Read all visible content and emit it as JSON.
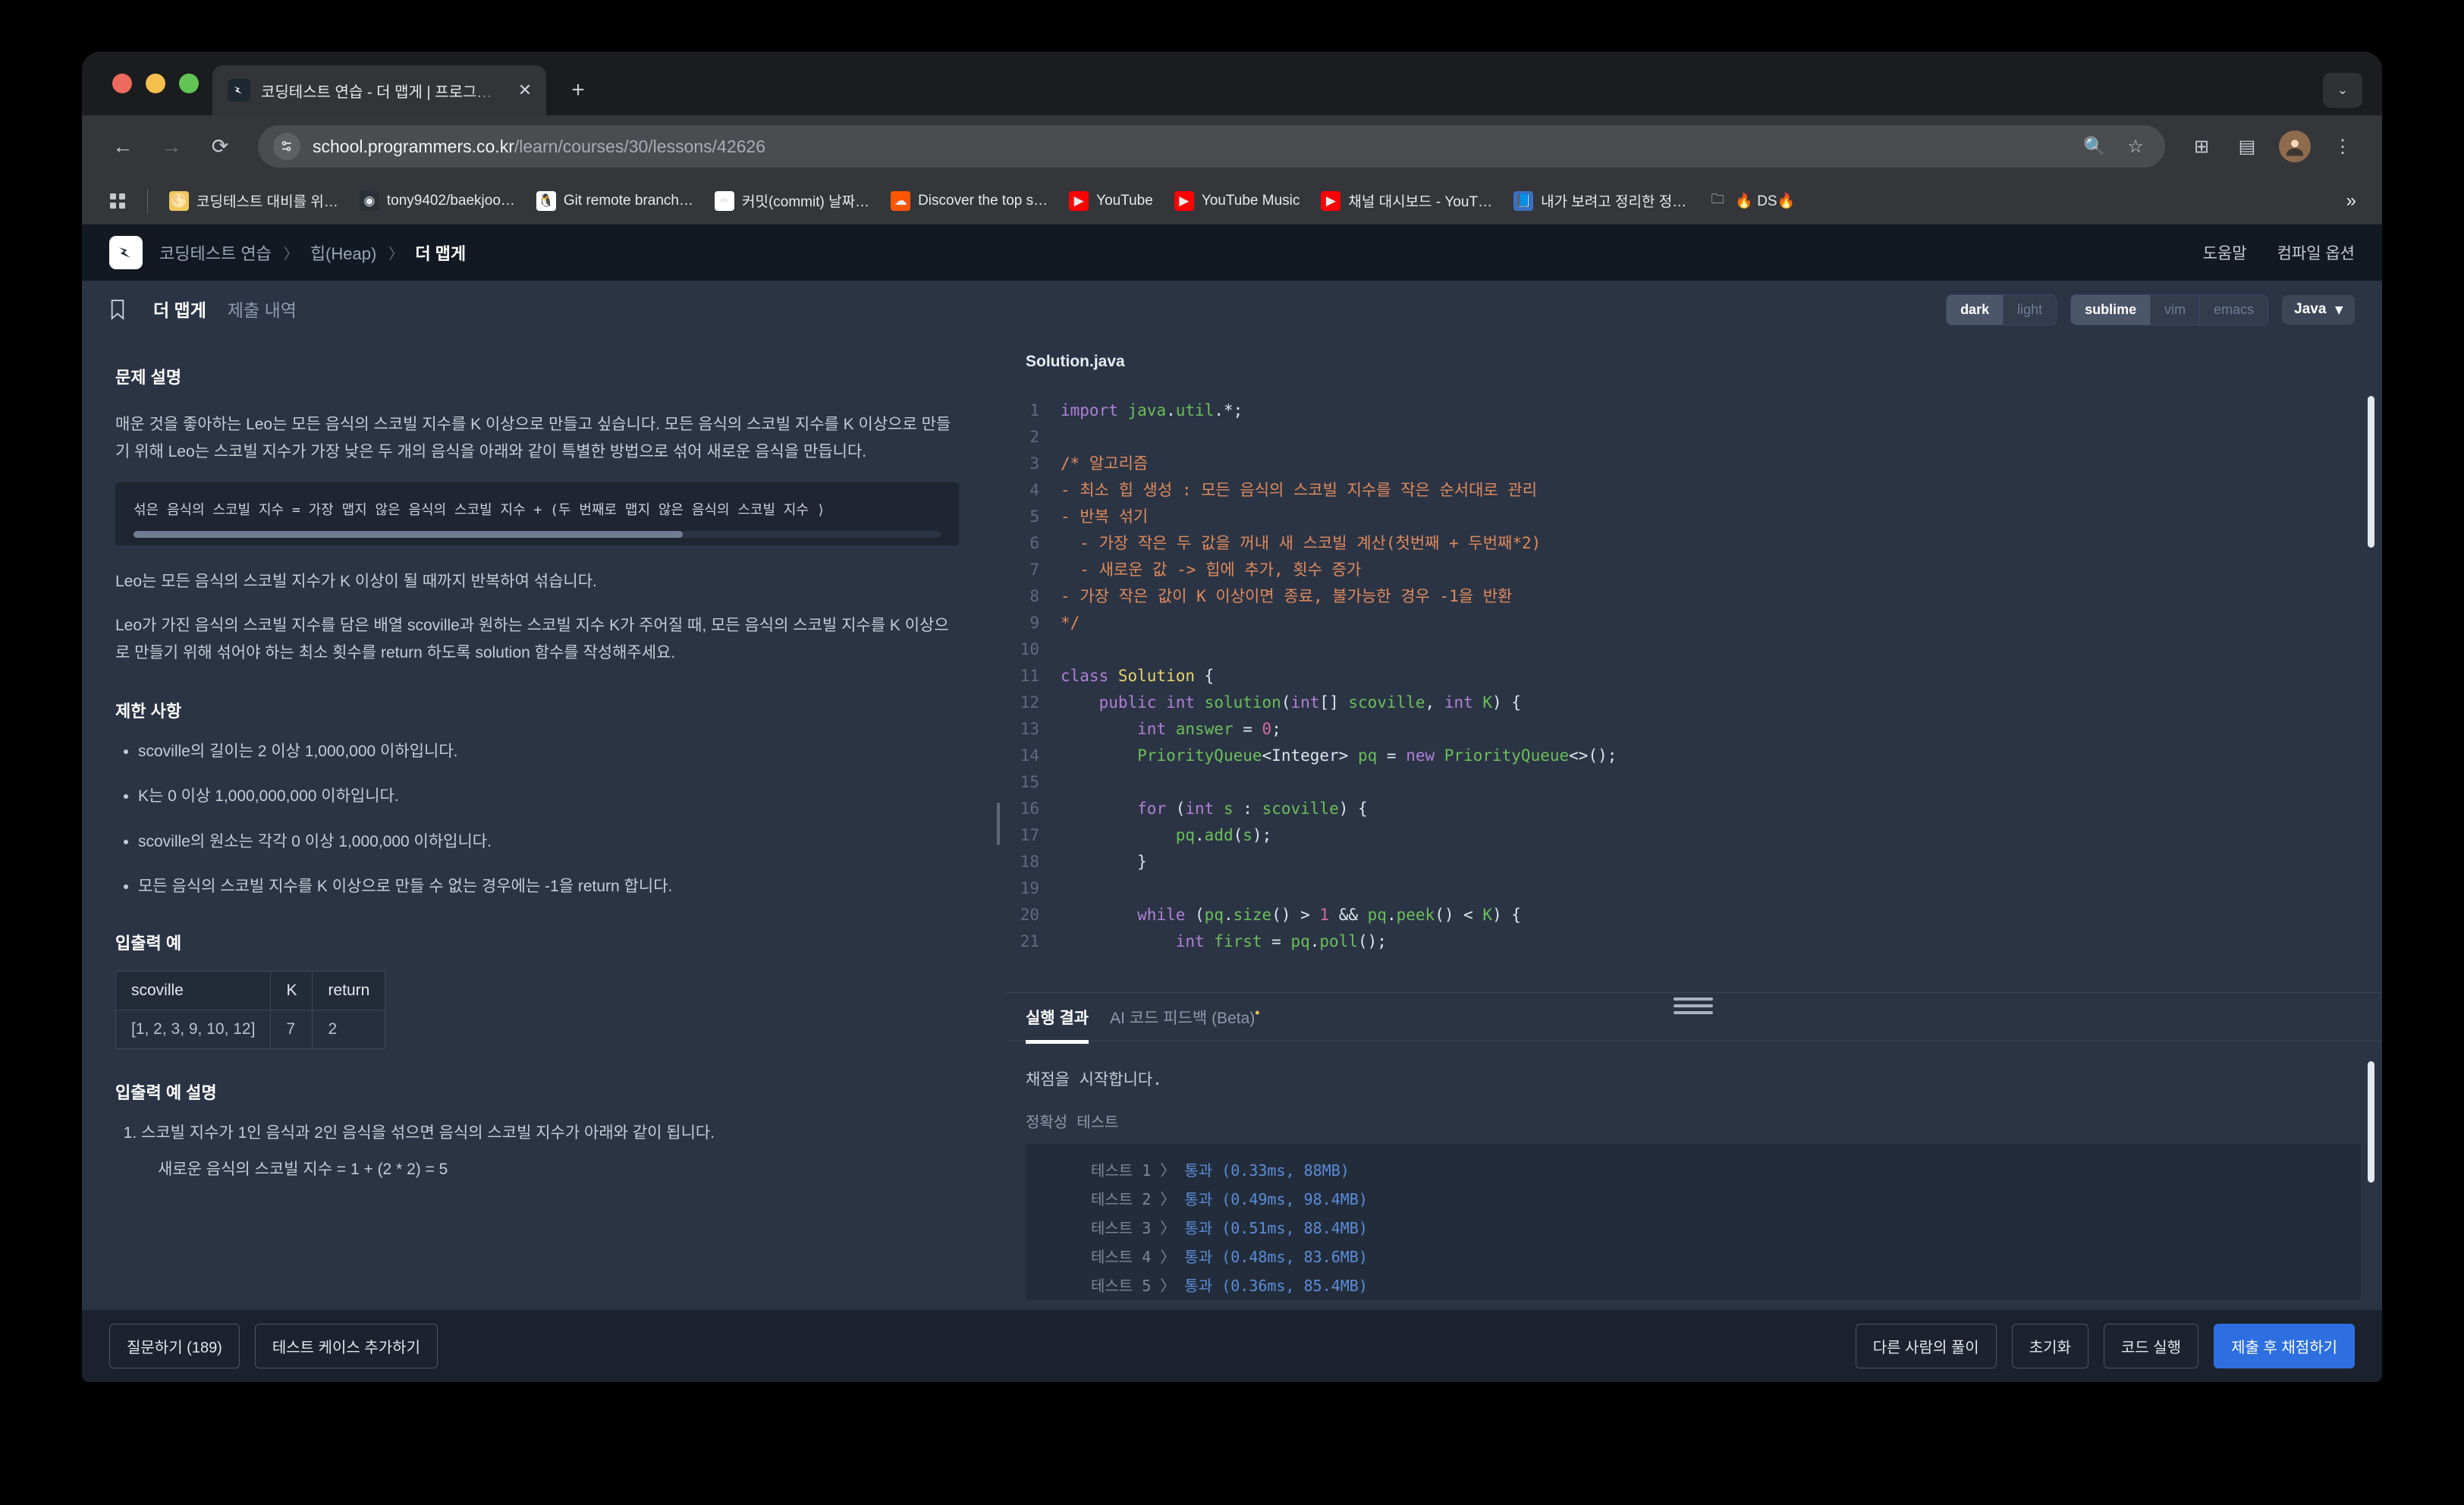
{
  "browser": {
    "tab": {
      "title": "코딩테스트 연습 - 더 맵게 | 프로그…",
      "close_label": "✕"
    },
    "new_tab_label": "+",
    "tabstrip_chevron": "⌄",
    "toolbar": {
      "back": "←",
      "forward": "→",
      "reload": "⟳",
      "url_host": "school.programmers.co.kr",
      "url_path": "/learn/courses/30/lessons/42626",
      "zoom_icon": "🔍",
      "star_icon": "☆",
      "extensions_icon": "⊞",
      "split_icon": "▤",
      "menu_icon": "⋮"
    },
    "bookmarks": [
      {
        "label": "코딩테스트 대비를 위…",
        "icon": "🌕",
        "icon_bg": "#f0c75e"
      },
      {
        "label": "tony9402/baekjoo…",
        "icon": "◉",
        "icon_bg": "#2b3036"
      },
      {
        "label": "Git remote branch…",
        "icon": "🐧",
        "icon_bg": "#ffffff"
      },
      {
        "label": "커밋(commit) 날짜…",
        "icon": "✒",
        "icon_bg": "#ffffff"
      },
      {
        "label": "Discover the top s…",
        "icon": "☁",
        "icon_bg": "#ff5500"
      },
      {
        "label": "YouTube",
        "icon": "▶",
        "icon_bg": "#ff0000"
      },
      {
        "label": "YouTube Music",
        "icon": "▶",
        "icon_bg": "#ff0000"
      },
      {
        "label": "채널 대시보드 - YouT…",
        "icon": "▶",
        "icon_bg": "#ff0000"
      },
      {
        "label": "내가 보려고 정리한 정…",
        "icon": "📘",
        "icon_bg": "#3b6fc4"
      },
      {
        "label": "🔥 DS🔥",
        "icon": "🗀",
        "icon_bg": "transparent"
      }
    ],
    "bookmarks_overflow": "»"
  },
  "site": {
    "breadcrumb": {
      "root": "코딩테스트 연습",
      "sep": "〉",
      "category": "힙(Heap)",
      "current": "더 맵게"
    },
    "header_links": [
      "도움말",
      "컴파일 옵션"
    ]
  },
  "problem_tabs": {
    "bookmark_icon": "bookmark-icon",
    "tabs": [
      {
        "label": "더 맵게",
        "active": true
      },
      {
        "label": "제출 내역",
        "active": false
      }
    ],
    "theme_options": [
      {
        "label": "dark",
        "active": true
      },
      {
        "label": "light",
        "active": false
      }
    ],
    "keymap_options": [
      {
        "label": "sublime",
        "active": true
      },
      {
        "label": "vim",
        "active": false
      },
      {
        "label": "emacs",
        "active": false
      }
    ],
    "language": {
      "label": "Java",
      "caret": "▾"
    }
  },
  "problem": {
    "heading_description": "문제 설명",
    "paragraphs": [
      "매운 것을 좋아하는 Leo는 모든 음식의 스코빌 지수를 K 이상으로 만들고 싶습니다. 모든 음식의 스코빌 지수를 K 이상으로 만들기 위해 Leo는 스코빌 지수가 가장 낮은 두 개의 음식을 아래와 같이 특별한 방법으로 섞어 새로운 음식을 만듭니다."
    ],
    "formula": "섞은 음식의 스코빌 지수 = 가장 맵지 않은 음식의 스코빌 지수 + (두 번째로 맵지 않은 음식의 스코빌 지수 ⟩",
    "paragraphs_after": [
      "Leo는 모든 음식의 스코빌 지수가 K 이상이 될 때까지 반복하여 섞습니다.",
      "Leo가 가진 음식의 스코빌 지수를 담은 배열 scoville과 원하는 스코빌 지수 K가 주어질 때, 모든 음식의 스코빌 지수를 K 이상으로 만들기 위해 섞어야 하는 최소 횟수를 return 하도록 solution 함수를 작성해주세요."
    ],
    "heading_constraints": "제한 사항",
    "constraints": [
      "scoville의 길이는 2 이상 1,000,000 이하입니다.",
      "K는 0 이상 1,000,000,000 이하입니다.",
      "scoville의 원소는 각각 0 이상 1,000,000 이하입니다.",
      "모든 음식의 스코빌 지수를 K 이상으로 만들 수 없는 경우에는 -1을 return 합니다."
    ],
    "heading_io": "입출력 예",
    "io_table": {
      "headers": [
        "scoville",
        "K",
        "return"
      ],
      "rows": [
        [
          "[1, 2, 3, 9, 10, 12]",
          "7",
          "2"
        ]
      ]
    },
    "heading_io_explain": "입출력 예 설명",
    "io_explain_items": [
      "스코빌 지수가 1인 음식과 2인 음식을 섞으면 음식의 스코빌 지수가 아래와 같이 됩니다."
    ],
    "io_explain_sub": "새로운 음식의 스코빌 지수 = 1 + (2 * 2) = 5"
  },
  "editor": {
    "filename": "Solution.java",
    "lines": [
      {
        "no": "1",
        "tokens": [
          {
            "t": "import ",
            "c": "k"
          },
          {
            "t": "java",
            "c": "t"
          },
          {
            "t": ".",
            "c": "op"
          },
          {
            "t": "util",
            "c": "t"
          },
          {
            "t": ".",
            "c": "op"
          },
          {
            "t": "*;",
            "c": "op"
          }
        ]
      },
      {
        "no": "2",
        "tokens": []
      },
      {
        "no": "3",
        "tokens": [
          {
            "t": "/* 알고리즘",
            "c": "cm"
          }
        ]
      },
      {
        "no": "4",
        "tokens": [
          {
            "t": "- 최소 힙 생성 : 모든 음식의 스코빌 지수를 작은 순서대로 관리",
            "c": "cm"
          }
        ]
      },
      {
        "no": "5",
        "tokens": [
          {
            "t": "- 반복 섞기",
            "c": "cm"
          }
        ]
      },
      {
        "no": "6",
        "tokens": [
          {
            "t": "  - 가장 작은 두 값을 꺼내 새 스코빌 계산(첫번째 + 두번째*2)",
            "c": "cm"
          }
        ]
      },
      {
        "no": "7",
        "tokens": [
          {
            "t": "  - 새로운 값 -> 힙에 추가, 횟수 증가",
            "c": "cm"
          }
        ]
      },
      {
        "no": "8",
        "tokens": [
          {
            "t": "- 가장 작은 값이 K 이상이면 종료, 불가능한 경우 -1을 반환",
            "c": "cm"
          }
        ]
      },
      {
        "no": "9",
        "tokens": [
          {
            "t": "*/",
            "c": "cm"
          }
        ]
      },
      {
        "no": "10",
        "tokens": []
      },
      {
        "no": "11",
        "tokens": [
          {
            "t": "class ",
            "c": "k"
          },
          {
            "t": "Solution",
            "c": "s"
          },
          {
            "t": " {",
            "c": "op"
          }
        ]
      },
      {
        "no": "12",
        "tokens": [
          {
            "t": "    ",
            "c": "op"
          },
          {
            "t": "public ",
            "c": "k"
          },
          {
            "t": "int ",
            "c": "k"
          },
          {
            "t": "solution",
            "c": "t"
          },
          {
            "t": "(",
            "c": "op"
          },
          {
            "t": "int",
            "c": "k"
          },
          {
            "t": "[] ",
            "c": "op"
          },
          {
            "t": "scoville",
            "c": "t"
          },
          {
            "t": ", ",
            "c": "op"
          },
          {
            "t": "int ",
            "c": "k"
          },
          {
            "t": "K",
            "c": "t"
          },
          {
            "t": ") {",
            "c": "op"
          }
        ]
      },
      {
        "no": "13",
        "tokens": [
          {
            "t": "        ",
            "c": "op"
          },
          {
            "t": "int ",
            "c": "k"
          },
          {
            "t": "answer",
            "c": "t"
          },
          {
            "t": " = ",
            "c": "op"
          },
          {
            "t": "0",
            "c": "n"
          },
          {
            "t": ";",
            "c": "op"
          }
        ]
      },
      {
        "no": "14",
        "tokens": [
          {
            "t": "        ",
            "c": "op"
          },
          {
            "t": "PriorityQueue",
            "c": "t"
          },
          {
            "t": "<Integer> ",
            "c": "op"
          },
          {
            "t": "pq",
            "c": "t"
          },
          {
            "t": " = ",
            "c": "op"
          },
          {
            "t": "new ",
            "c": "k"
          },
          {
            "t": "PriorityQueue",
            "c": "t"
          },
          {
            "t": "<>();",
            "c": "op"
          }
        ]
      },
      {
        "no": "15",
        "tokens": []
      },
      {
        "no": "16",
        "tokens": [
          {
            "t": "        ",
            "c": "op"
          },
          {
            "t": "for ",
            "c": "k"
          },
          {
            "t": "(",
            "c": "op"
          },
          {
            "t": "int ",
            "c": "k"
          },
          {
            "t": "s",
            "c": "t"
          },
          {
            "t": " : ",
            "c": "op"
          },
          {
            "t": "scoville",
            "c": "t"
          },
          {
            "t": ") {",
            "c": "op"
          }
        ]
      },
      {
        "no": "17",
        "tokens": [
          {
            "t": "            ",
            "c": "op"
          },
          {
            "t": "pq",
            "c": "t"
          },
          {
            "t": ".",
            "c": "op"
          },
          {
            "t": "add",
            "c": "t"
          },
          {
            "t": "(",
            "c": "op"
          },
          {
            "t": "s",
            "c": "t"
          },
          {
            "t": ");",
            "c": "op"
          }
        ]
      },
      {
        "no": "18",
        "tokens": [
          {
            "t": "        }",
            "c": "op"
          }
        ]
      },
      {
        "no": "19",
        "tokens": []
      },
      {
        "no": "20",
        "tokens": [
          {
            "t": "        ",
            "c": "op"
          },
          {
            "t": "while ",
            "c": "k"
          },
          {
            "t": "(",
            "c": "op"
          },
          {
            "t": "pq",
            "c": "t"
          },
          {
            "t": ".",
            "c": "op"
          },
          {
            "t": "size",
            "c": "t"
          },
          {
            "t": "() > ",
            "c": "op"
          },
          {
            "t": "1",
            "c": "n"
          },
          {
            "t": " && ",
            "c": "op"
          },
          {
            "t": "pq",
            "c": "t"
          },
          {
            "t": ".",
            "c": "op"
          },
          {
            "t": "peek",
            "c": "t"
          },
          {
            "t": "() < ",
            "c": "op"
          },
          {
            "t": "K",
            "c": "t"
          },
          {
            "t": ") {",
            "c": "op"
          }
        ]
      },
      {
        "no": "21",
        "tokens": [
          {
            "t": "            ",
            "c": "op"
          },
          {
            "t": "int ",
            "c": "k"
          },
          {
            "t": "first",
            "c": "t"
          },
          {
            "t": " = ",
            "c": "op"
          },
          {
            "t": "pq",
            "c": "t"
          },
          {
            "t": ".",
            "c": "op"
          },
          {
            "t": "poll",
            "c": "t"
          },
          {
            "t": "();",
            "c": "op"
          }
        ]
      }
    ]
  },
  "result": {
    "tabs": [
      {
        "label": "실행 결과",
        "active": true
      },
      {
        "label": "AI 코드 피드백 (Beta)",
        "active": false,
        "badge": "•"
      }
    ],
    "status": "채점을 시작합니다.",
    "section_label": "정확성  테스트",
    "tests": [
      {
        "name": "테스트 1 〉",
        "result": "통과 (0.33ms, 88MB)"
      },
      {
        "name": "테스트 2 〉",
        "result": "통과 (0.49ms, 98.4MB)"
      },
      {
        "name": "테스트 3 〉",
        "result": "통과 (0.51ms, 88.4MB)"
      },
      {
        "name": "테스트 4 〉",
        "result": "통과 (0.48ms, 83.6MB)"
      },
      {
        "name": "테스트 5 〉",
        "result": "통과 (0.36ms, 85.4MB)"
      }
    ]
  },
  "actions": {
    "left": [
      {
        "label": "질문하기 (189)",
        "primary": false
      },
      {
        "label": "테스트 케이스 추가하기",
        "primary": false
      }
    ],
    "right": [
      {
        "label": "다른 사람의 풀이",
        "primary": false
      },
      {
        "label": "초기화",
        "primary": false
      },
      {
        "label": "코드 실행",
        "primary": false
      },
      {
        "label": "제출 후 채점하기",
        "primary": true
      }
    ]
  },
  "colors": {
    "accent": "#2d6fe0",
    "pass": "#5b8dd9",
    "panel": "#2b3444",
    "page_bg": "#101720"
  }
}
